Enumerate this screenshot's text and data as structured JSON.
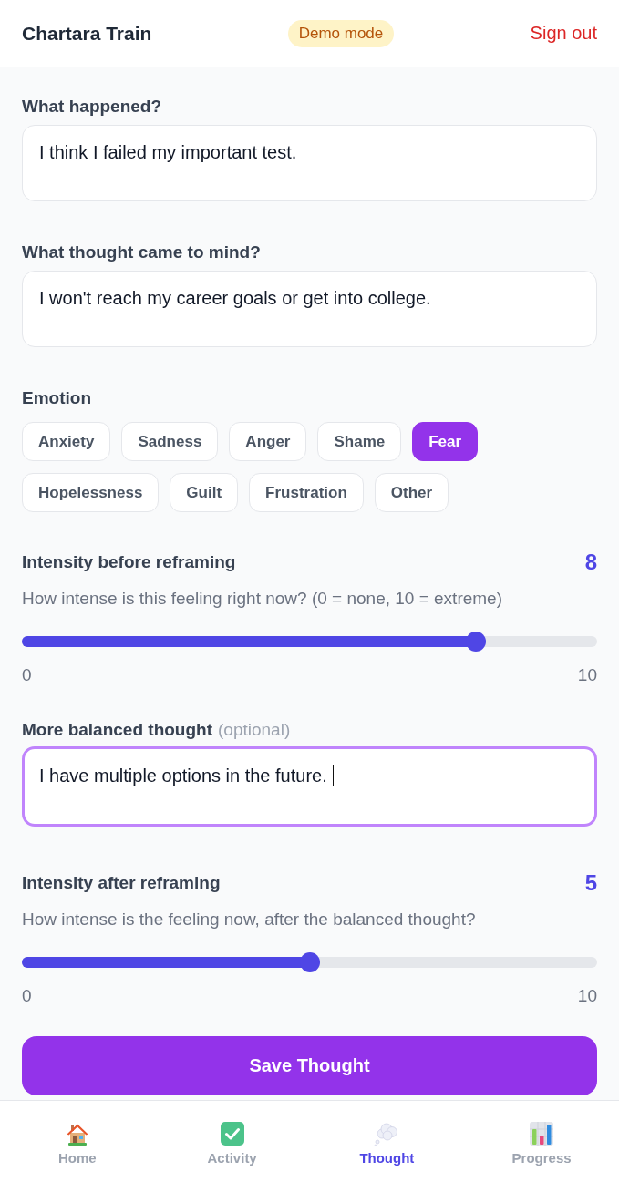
{
  "header": {
    "title": "Chartara Train",
    "badge": "Demo mode",
    "sign_out": "Sign out"
  },
  "form": [
    {
      "kind": "text",
      "label": "What happened?",
      "value": "I think I failed my important test.",
      "focused": false
    },
    {
      "kind": "text",
      "label": "What thought came to mind?",
      "value": "I won't reach my career goals or get into college.",
      "focused": false
    },
    {
      "kind": "choices",
      "label": "Emotion",
      "options": [
        {
          "label": "Anxiety",
          "selected": false
        },
        {
          "label": "Sadness",
          "selected": false
        },
        {
          "label": "Anger",
          "selected": false
        },
        {
          "label": "Shame",
          "selected": false
        },
        {
          "label": "Fear",
          "selected": true
        },
        {
          "label": "Hopelessness",
          "selected": false
        },
        {
          "label": "Guilt",
          "selected": false
        },
        {
          "label": "Frustration",
          "selected": false
        },
        {
          "label": "Other",
          "selected": false
        }
      ]
    },
    {
      "kind": "scale",
      "label": "Intensity before reframing",
      "reading": "8",
      "hint": "How intense is this feeling right now? (0 = none, 10 = extreme)",
      "level": 0.8,
      "min_label": "0",
      "max_label": "10"
    },
    {
      "kind": "text",
      "label": "More balanced thought",
      "note": "(optional)",
      "value": "I have multiple options in the future.",
      "focused": true
    },
    {
      "kind": "scale",
      "label": "Intensity after reframing",
      "reading": "5",
      "hint": "How intense is the feeling now, after the balanced thought?",
      "level": 0.5,
      "min_label": "0",
      "max_label": "10"
    }
  ],
  "save_button": "Save Thought",
  "nav": [
    {
      "kind": "home",
      "label": "Home",
      "selected": false
    },
    {
      "kind": "activity",
      "label": "Activity",
      "selected": false
    },
    {
      "kind": "thought",
      "label": "Thought",
      "selected": true
    },
    {
      "kind": "progress",
      "label": "Progress",
      "selected": false
    }
  ]
}
